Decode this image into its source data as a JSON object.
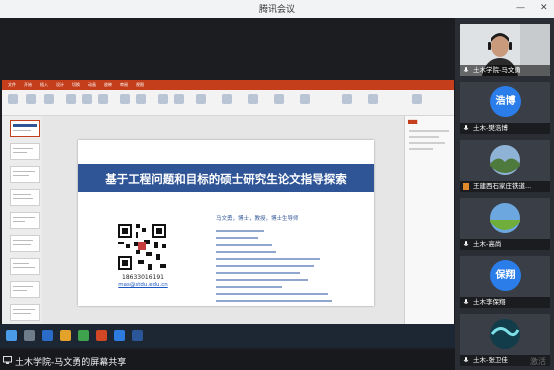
{
  "app": {
    "title": "腾讯会议"
  },
  "ppt": {
    "ribbon_tabs": [
      "文件",
      "开始",
      "插入",
      "设计",
      "切换",
      "动画",
      "放映",
      "审阅",
      "视图"
    ],
    "accent": "#c43e1c",
    "slide": {
      "title": "基于工程问题和目标的硕士研究生论文指导探索",
      "authors": "马文勇，博士，教授，博士生导师",
      "phone": "18633016191",
      "email": "mas@stdu.edu.cn",
      "banner_color": "#2f5597"
    }
  },
  "share": {
    "label": "土木学院-马文勇的屏幕共享"
  },
  "participants": [
    {
      "name": "土木学院-马文勇",
      "kind": "video-person"
    },
    {
      "name": "土木-樊浩博",
      "avatar_text": "浩博",
      "avatar_color": "#2b7de9"
    },
    {
      "name": "王建西石家庄铁道...",
      "kind": "landscape"
    },
    {
      "name": "土木-高尚",
      "kind": "field"
    },
    {
      "name": "土木李保翔",
      "avatar_text": "保翔",
      "avatar_color": "#2b7de9"
    },
    {
      "name": "土木-张卫佳",
      "kind": "aurora"
    }
  ],
  "watermark": "激活"
}
